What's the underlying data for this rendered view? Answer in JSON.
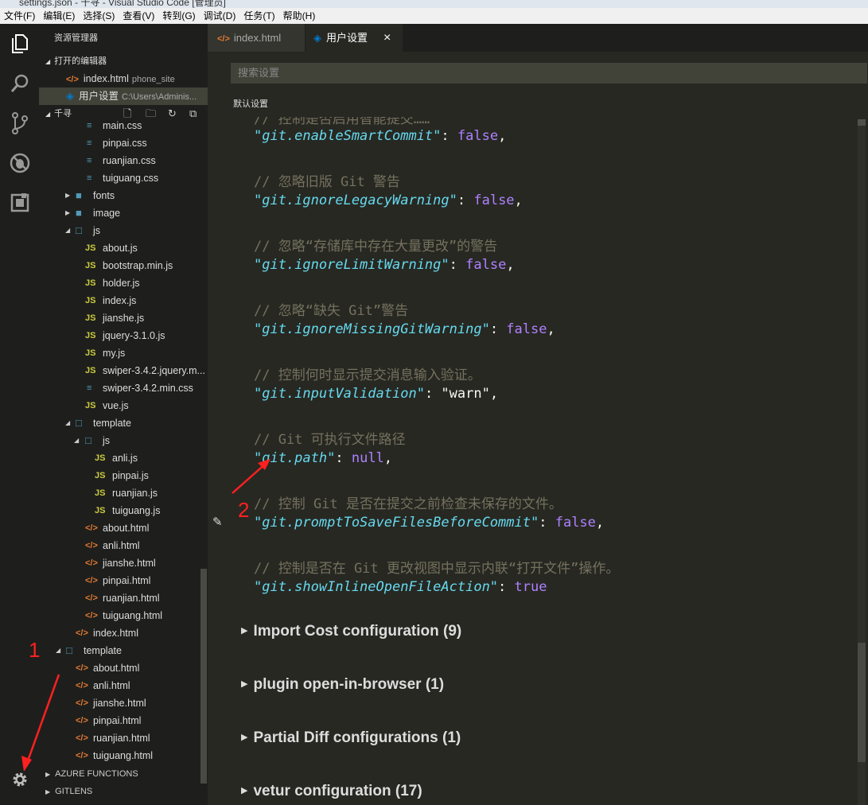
{
  "window": {
    "title": "settings.json - 千寻 - Visual Studio Code [管理员]"
  },
  "menu": [
    "文件(F)",
    "编辑(E)",
    "选择(S)",
    "查看(V)",
    "转到(G)",
    "调试(D)",
    "任务(T)",
    "帮助(H)"
  ],
  "sidebar": {
    "title": "资源管理器",
    "open_editors_label": "打开的编辑器",
    "open_editors": [
      {
        "name": "index.html",
        "desc": "phone_site"
      },
      {
        "name": "用户设置",
        "desc": "C:\\Users\\Adminis..."
      }
    ],
    "project_label": "千寻",
    "bottom_sections": [
      "AZURE FUNCTIONS",
      "GITLENS"
    ]
  },
  "tree": [
    {
      "name": "main.css"
    },
    {
      "name": "pinpai.css"
    },
    {
      "name": "ruanjian.css"
    },
    {
      "name": "tuiguang.css"
    },
    {
      "name": "fonts"
    },
    {
      "name": "image"
    },
    {
      "name": "js"
    },
    {
      "name": "about.js"
    },
    {
      "name": "bootstrap.min.js"
    },
    {
      "name": "holder.js"
    },
    {
      "name": "index.js"
    },
    {
      "name": "jianshe.js"
    },
    {
      "name": "jquery-3.1.0.js"
    },
    {
      "name": "my.js"
    },
    {
      "name": "swiper-3.4.2.jquery.m..."
    },
    {
      "name": "swiper-3.4.2.min.css"
    },
    {
      "name": "vue.js"
    },
    {
      "name": "template"
    },
    {
      "name": "js"
    },
    {
      "name": "anli.js"
    },
    {
      "name": "pinpai.js"
    },
    {
      "name": "ruanjian.js"
    },
    {
      "name": "tuiguang.js"
    },
    {
      "name": "about.html"
    },
    {
      "name": "anli.html"
    },
    {
      "name": "jianshe.html"
    },
    {
      "name": "pinpai.html"
    },
    {
      "name": "ruanjian.html"
    },
    {
      "name": "tuiguang.html"
    },
    {
      "name": "index.html"
    },
    {
      "name": "template"
    },
    {
      "name": "about.html"
    },
    {
      "name": "anli.html"
    },
    {
      "name": "jianshe.html"
    },
    {
      "name": "pinpai.html"
    },
    {
      "name": "ruanjian.html"
    },
    {
      "name": "tuiguang.html"
    }
  ],
  "tabs": [
    {
      "label": "index.html"
    },
    {
      "label": "用户设置",
      "close": "×"
    }
  ],
  "search": {
    "placeholder": "搜索设置"
  },
  "default_settings_label": "默认设置",
  "settings": [
    {
      "comment": "// 忽略旧版 Git 警告",
      "key": "\"git.ignoreLegacyWarning\"",
      "value": "false",
      "comma": ","
    },
    {
      "comment": "// 忽略“存储库中存在大量更改”的警告",
      "key": "\"git.ignoreLimitWarning\"",
      "value": "false",
      "comma": ","
    },
    {
      "comment": "// 忽略“缺失 Git”警告",
      "key": "\"git.ignoreMissingGitWarning\"",
      "value": "false",
      "comma": ","
    },
    {
      "comment": "// 控制何时显示提交消息输入验证。",
      "key": "\"git.inputValidation\"",
      "value": "\"warn\"",
      "comma": ","
    },
    {
      "comment": "// Git 可执行文件路径",
      "key": "\"git.path\"",
      "value": "null",
      "comma": ","
    },
    {
      "comment": "// 控制 Git 是否在提交之前检查未保存的文件。",
      "key": "\"git.promptToSaveFilesBeforeCommit\"",
      "value": "false",
      "comma": ","
    },
    {
      "comment": "// 控制是否在 Git 更改视图中显示内联“打开文件”操作。",
      "key": "\"git.showInlineOpenFileAction\"",
      "value": "true",
      "comma": ""
    }
  ],
  "first_setting": {
    "key": "\"git.enableSmartCommit\"",
    "value": "false",
    "comma": ","
  },
  "groups": [
    "Import Cost configuration (9)",
    "plugin open-in-browser (1)",
    "Partial Diff configurations (1)",
    "vetur configuration (17)"
  ],
  "annotations": [
    "1",
    "2"
  ]
}
